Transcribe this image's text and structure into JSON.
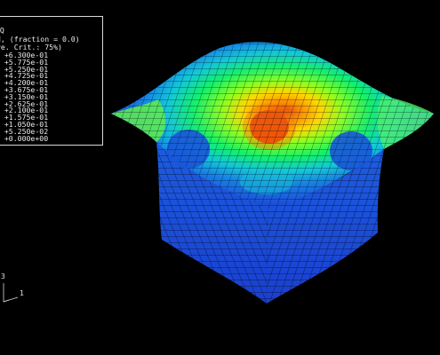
{
  "legend": {
    "header_lines": [
      "EQ",
      "d, (fraction = 0.0)",
      "ve. Crit.: 75%)"
    ],
    "values": [
      "+6.300e-01",
      "+5.775e-01",
      "+5.250e-01",
      "+4.725e-01",
      "+4.200e-01",
      "+3.675e-01",
      "+3.150e-01",
      "+2.625e-01",
      "+2.100e-01",
      "+1.575e-01",
      "+1.050e-01",
      "+5.250e-02",
      "+0.000e+00"
    ],
    "colors": [
      "#ff0000",
      "#ff5a00",
      "#ff9a00",
      "#ffd000",
      "#e8ff00",
      "#9bff00",
      "#3bff2a",
      "#00ff82",
      "#00f0d0",
      "#00b4ff",
      "#0072ff",
      "#0034ff",
      "#0000ff"
    ]
  },
  "triad": {
    "axis_up": "3",
    "axis_right": "1"
  },
  "mesh": {
    "peak_color": "#e8400a",
    "base_color": "#1c47d6",
    "grid_color": "#0a0a0a"
  }
}
